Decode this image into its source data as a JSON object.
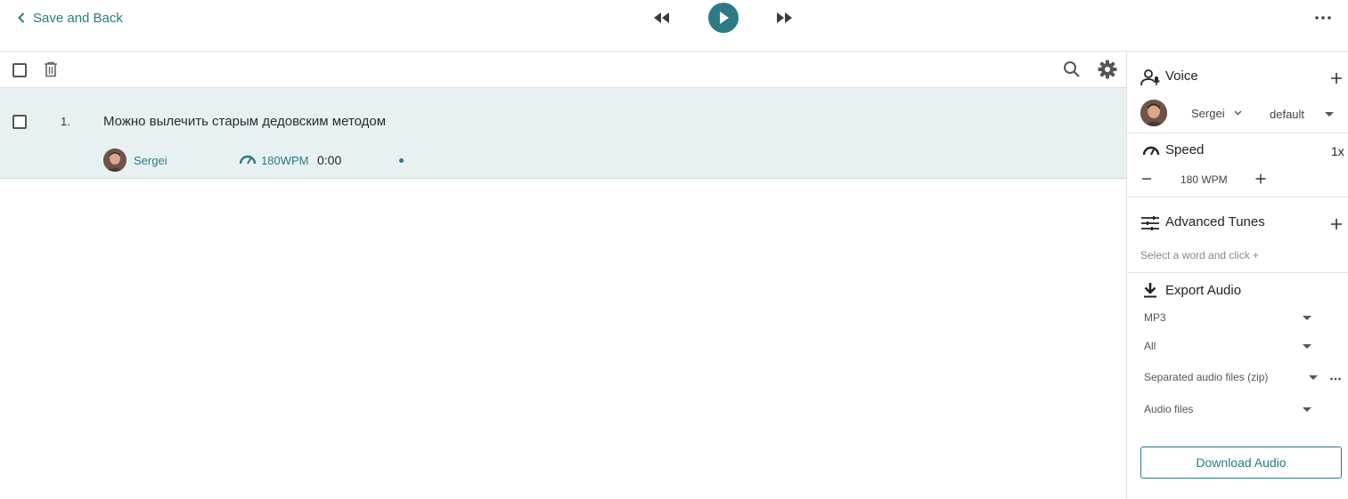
{
  "header": {
    "back_label": "Save and Back"
  },
  "icons": {
    "back": "chevron-left-icon",
    "rewind": "rewind-icon",
    "play": "play-icon",
    "fast_forward": "fast-forward-icon",
    "more": "more-horizontal-icon",
    "trash": "trash-icon",
    "search": "search-icon",
    "settings": "gear-icon"
  },
  "colors": {
    "accent": "#2b7a86",
    "row_background": "#e8f1f2"
  },
  "script": {
    "rows": [
      {
        "number": "1.",
        "text": "Можно вылечить старым дедовским методом",
        "voice": "Sergei",
        "wpm": "180WPM",
        "duration": "0:00"
      }
    ]
  },
  "panel": {
    "voice": {
      "title": "Voice",
      "name": "Sergei",
      "style": "default"
    },
    "speed": {
      "title": "Speed",
      "multiplier": "1x",
      "value": "180 WPM"
    },
    "advanced": {
      "title": "Advanced Tunes",
      "hint": "Select a word and click +"
    },
    "export": {
      "title": "Export Audio",
      "format": "MP3",
      "range": "All",
      "packaging": "Separated audio files (zip)",
      "content": "Audio files",
      "download_label": "Download Audio"
    }
  }
}
